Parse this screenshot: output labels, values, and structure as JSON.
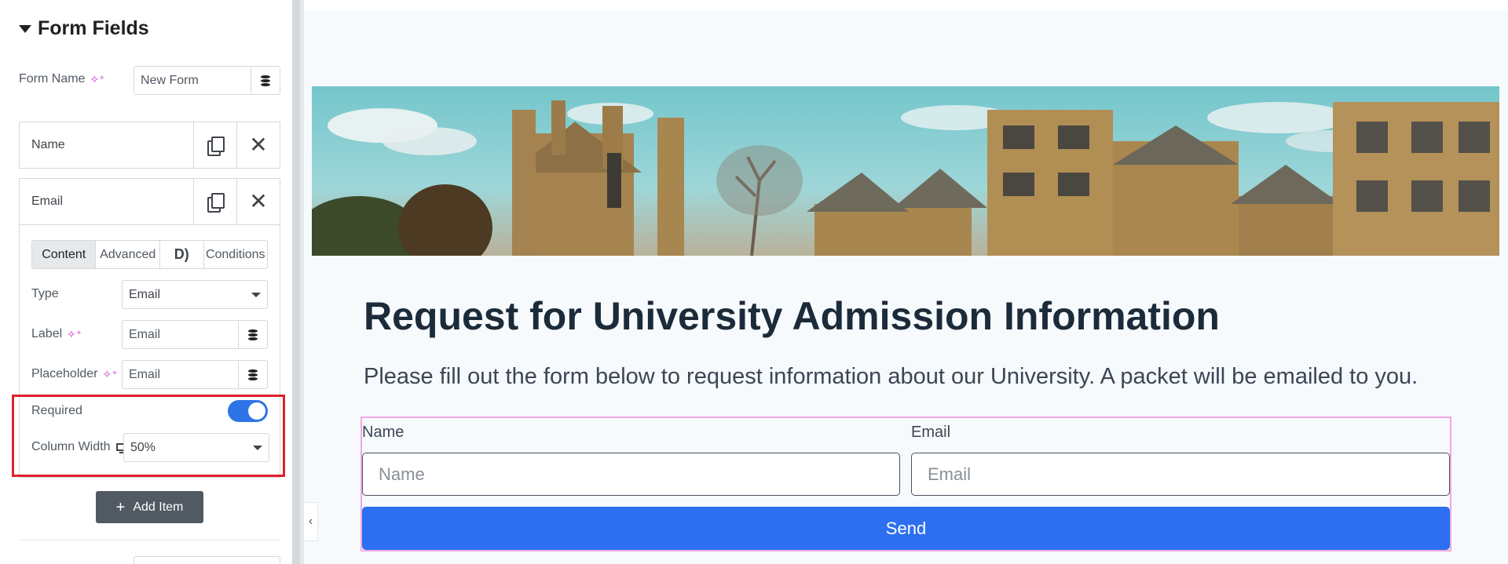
{
  "panel": {
    "section_title": "Form Fields",
    "form_name": {
      "label": "Form Name",
      "value": "New Form"
    },
    "items": [
      {
        "title": "Name"
      },
      {
        "title": "Email"
      }
    ],
    "tabs": [
      "Content",
      "Advanced",
      "Conditions"
    ],
    "fields": {
      "type": {
        "label": "Type",
        "value": "Email"
      },
      "label": {
        "label": "Label",
        "value": "Email"
      },
      "placeholder": {
        "label": "Placeholder",
        "value": "Email"
      },
      "required": {
        "label": "Required",
        "on": true
      },
      "column_width": {
        "label": "Column Width",
        "value": "50%"
      }
    },
    "add_item_label": "Add Item"
  },
  "preview": {
    "title": "Request for University Admission Information",
    "subtitle": "Please fill out the form below to request information about our University. A packet will be emailed to you.",
    "form": {
      "name_label": "Name",
      "name_placeholder": "Name",
      "email_label": "Email",
      "email_placeholder": "Email",
      "send_label": "Send"
    }
  },
  "colors": {
    "accent": "#2d74e6",
    "send_button": "#2d6ff0",
    "highlight": "#e0202b",
    "form_outline": "#f0a7e0"
  }
}
